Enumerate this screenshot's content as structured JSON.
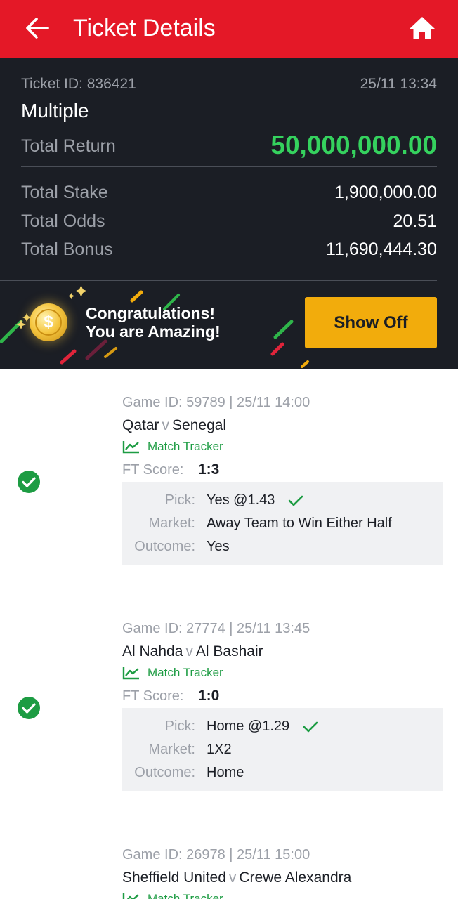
{
  "header": {
    "title": "Ticket Details",
    "back_icon": "arrow-left-icon",
    "home_icon": "home-icon",
    "color": "#e41827"
  },
  "summary": {
    "ticket_id": "Ticket ID: 836421",
    "timestamp": "25/11 13:34",
    "bet_type": "Multiple",
    "total_return_label": "Total Return",
    "total_return": "50,000,000.00",
    "total_stake_label": "Total Stake",
    "total_stake": "1,900,000.00",
    "total_odds_label": "Total Odds",
    "total_odds": "20.51",
    "total_bonus_label": "Total Bonus",
    "total_bonus": "11,690,444.30"
  },
  "banner": {
    "line1": "Congratulations!",
    "line2": "You are Amazing!",
    "button_label": "Show Off",
    "coin_symbol": "$",
    "button_color": "#f2ac0c"
  },
  "games": [
    {
      "meta": "Game ID: 59789 | 25/11 14:00",
      "home": "Qatar",
      "sep": "v",
      "away": "Senegal",
      "tracker": "Match Tracker",
      "ft_label": "FT Score:",
      "ft_score": "1:3",
      "pick_label": "Pick:",
      "pick": "Yes @1.43",
      "market_label": "Market:",
      "market": "Away Team to Win Either Half",
      "outcome_label": "Outcome:",
      "outcome": "Yes",
      "status_icon": "check-circle-icon"
    },
    {
      "meta": "Game ID: 27774 | 25/11 13:45",
      "home": "Al Nahda",
      "sep": "v",
      "away": "Al Bashair",
      "tracker": "Match Tracker",
      "ft_label": "FT Score:",
      "ft_score": "1:0",
      "pick_label": "Pick:",
      "pick": "Home @1.29",
      "market_label": "Market:",
      "market": "1X2",
      "outcome_label": "Outcome:",
      "outcome": "Home",
      "status_icon": "check-circle-icon"
    },
    {
      "meta": "Game ID: 26978 | 25/11 15:00",
      "home": "Sheffield United",
      "sep": "v",
      "away": "Crewe Alexandra",
      "tracker": "Match Tracker"
    }
  ],
  "colors": {
    "win_green": "#35d25e",
    "success": "#1d9c43",
    "panel_dark": "#1b1e25"
  }
}
